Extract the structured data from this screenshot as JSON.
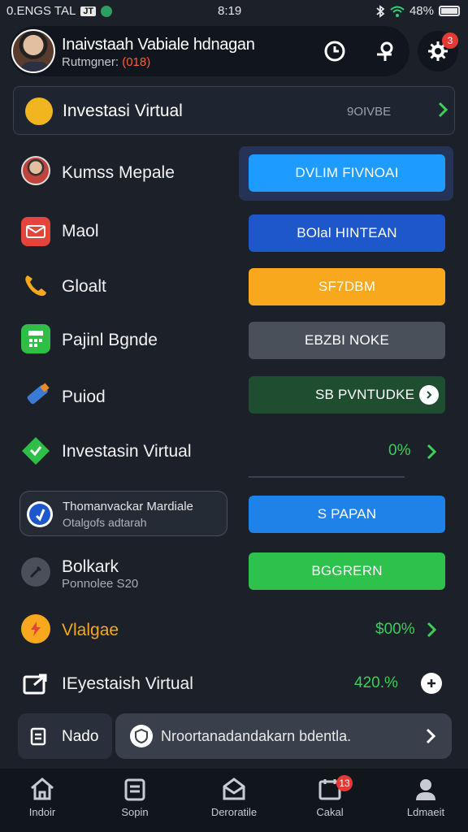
{
  "status_bar": {
    "left_text": "0.ENGS TAL",
    "chip": "JT",
    "time": "8:19",
    "battery": "48%"
  },
  "header": {
    "name": "Inaivstaah Vabiale hdnagan",
    "sub_prefix": "Rutmgner:",
    "sub_highlight": "(018)",
    "gear_badge": "3"
  },
  "top_card": {
    "title": "Investasi Virtual",
    "value": "9OIVBE"
  },
  "rows": [
    {
      "label": "Kumss Mepale",
      "button": "DVLIM FIVNOAI",
      "color": "#1e9bff"
    },
    {
      "label": "Maol",
      "button": "BOlal HINTEAN",
      "color": "#1d57c9"
    },
    {
      "label": "Gloalt",
      "button": "SF7DBM",
      "color": "#f7a81c"
    },
    {
      "label": "Pajinl Bgnde",
      "button": "EBZBI NOKE",
      "color": "#4a505a"
    },
    {
      "label": "Puiod",
      "button": "SB  PVNTUDKE",
      "color": "#1e4d2f"
    },
    {
      "label": "Investasin Virtual",
      "value": "0%"
    },
    {
      "label": "Thomanvackar Mardiale",
      "sub": "Otalgofs adtarah",
      "button": "S PAPAN",
      "color": "#1e82e8"
    },
    {
      "label": "Bolkark",
      "sub": "Ponnolee S20",
      "button": "BGGRERN",
      "color": "#2ec14b"
    },
    {
      "label": "Vlalgae",
      "value": "$00%"
    },
    {
      "label": "IEyestaish Virtual",
      "value": "420.%"
    }
  ],
  "search": {
    "left_label": "Nado",
    "text": "Nroortanadandakarn bdentla."
  },
  "nav": [
    {
      "label": "Indoir"
    },
    {
      "label": "Sopin"
    },
    {
      "label": "Deroratile"
    },
    {
      "label": "Cakal",
      "badge": "13"
    },
    {
      "label": "Ldmaeit"
    }
  ]
}
